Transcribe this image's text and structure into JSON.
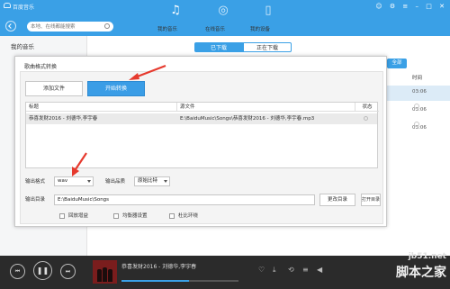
{
  "app": {
    "title": "百度音乐"
  },
  "search": {
    "placeholder": "本地、在线都能搜索"
  },
  "nav": [
    {
      "label": "我的音乐",
      "icon": "music-note-icon"
    },
    {
      "label": "在线音乐",
      "icon": "globe-icon"
    },
    {
      "label": "我的设备",
      "icon": "device-icon"
    }
  ],
  "sidebar": {
    "title": "我的音乐"
  },
  "tabs": {
    "downloaded": "已下载",
    "downloading": "正在下载"
  },
  "right": {
    "select_all": "全部",
    "time_header": "时间",
    "times": [
      "03:06",
      "03:06",
      "03:06"
    ]
  },
  "dialog": {
    "title": "歌曲格式转换",
    "add_file": "添加文件",
    "start_convert": "开始转换",
    "columns": {
      "title": "标题",
      "source": "源文件",
      "status": "状态"
    },
    "rows": [
      {
        "title": "恭喜发财2016 - 刘德华,李宇春",
        "source": "E:\\BaiduMusic\\Songs\\恭喜发财2016 - 刘德华,李宇春.mp3"
      }
    ],
    "output_format_label": "输出格式",
    "output_format_value": "wav",
    "output_quality_label": "输出品质",
    "output_quality_value": "原始比特",
    "output_dir_label": "输出目录",
    "output_dir_value": "E:\\BaiduMusic\\Songs",
    "change_dir": "更改目录",
    "open_dir": "打开目录",
    "options": [
      "回放增益",
      "均衡器设置",
      "杜比环绕"
    ]
  },
  "player": {
    "song": "恭喜发财2016 - 刘德华,李宇春",
    "progress": 0.58
  },
  "watermark": {
    "url": "jb51.net",
    "name": "脚本之家"
  },
  "colors": {
    "accent": "#3aa0e6",
    "arrow": "#e63a2e"
  }
}
